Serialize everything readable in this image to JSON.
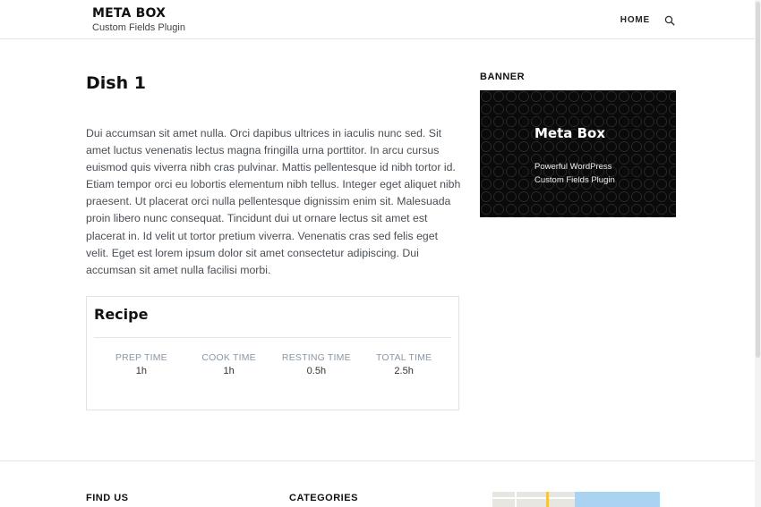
{
  "header": {
    "site_title": "META BOX",
    "tagline": "Custom Fields Plugin",
    "nav": {
      "home_label": "HOME"
    }
  },
  "post": {
    "title": "Dish 1",
    "content": "Dui accumsan sit amet nulla. Orci dapibus ultrices in iaculis nunc sed. Sit amet luctus venenatis lectus magna fringilla urna porttitor. In arcu cursus euismod quis viverra nibh cras pulvinar. Mattis pellentesque id nibh tortor id. Etiam tempor orci eu lobortis elementum nibh tellus. Integer eget aliquet nibh praesent. Ut placerat orci nulla pellentesque dignissim enim sit. Malesuada proin libero nunc consequat. Tincidunt dui ut ornare lectus sit amet est placerat in. Id velit ut tortor pretium viverra. Venenatis cras sed felis eget velit. Eget est lorem ipsum dolor sit amet consectetur adipiscing. Dui accumsan sit amet nulla facilisi morbi."
  },
  "recipe": {
    "title": "Recipe",
    "times": [
      {
        "label": "PREP TIME",
        "value": "1h"
      },
      {
        "label": "COOK TIME",
        "value": "1h"
      },
      {
        "label": "RESTING TIME",
        "value": "0.5h"
      },
      {
        "label": "TOTAL TIME",
        "value": "2.5h"
      }
    ]
  },
  "sidebar": {
    "widget_title": "BANNER",
    "banner": {
      "title": "Meta Box",
      "line1": "Powerful WordPress",
      "line2": "Custom Fields Plugin"
    }
  },
  "footer": {
    "find_us": "FIND US",
    "categories": "CATEGORIES"
  },
  "icons": {
    "search": "search-icon"
  }
}
